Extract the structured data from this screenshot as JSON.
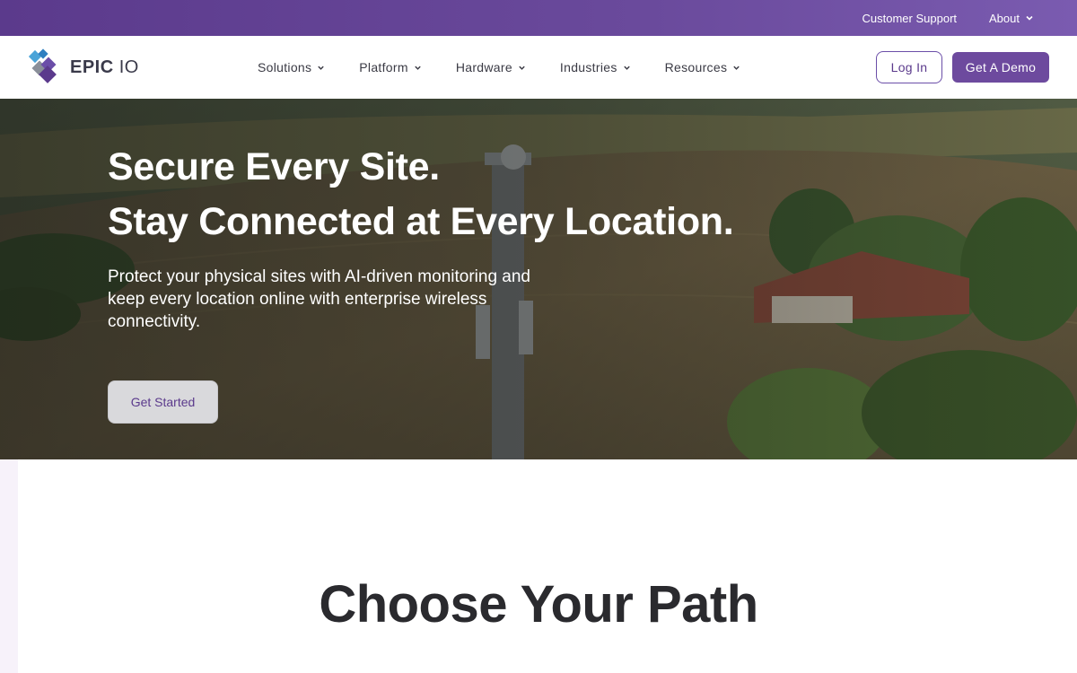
{
  "utility_bar": {
    "customer_support": "Customer Support",
    "about": "About"
  },
  "brand": {
    "name_bold": "EPIC",
    "name_light": "IO",
    "accent": "#5b3a8c"
  },
  "nav": {
    "items": [
      {
        "label": "Solutions"
      },
      {
        "label": "Platform"
      },
      {
        "label": "Hardware"
      },
      {
        "label": "Industries"
      },
      {
        "label": "Resources"
      }
    ],
    "login": "Log In",
    "demo": "Get A Demo"
  },
  "hero": {
    "title_line1": "Secure Every Site.",
    "title_line2": "Stay Connected at Every Location.",
    "subtitle": "Protect your physical sites with AI-driven monitoring and keep every location online with enterprise wireless connectivity.",
    "cta": "Get Started"
  },
  "section": {
    "title": "Choose Your Path"
  },
  "icons": [
    "chevron-down-icon",
    "epic-io-logo-mark"
  ]
}
